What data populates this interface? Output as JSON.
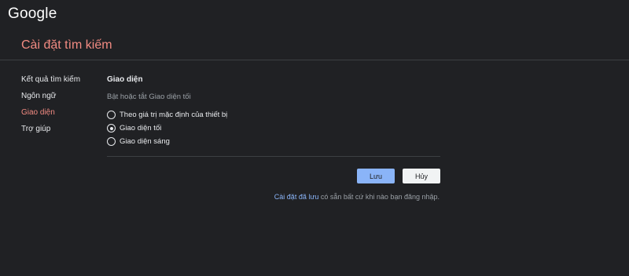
{
  "app": {
    "logo": "Google"
  },
  "header": {
    "title": "Cài đặt tìm kiếm"
  },
  "sidebar": {
    "items": [
      {
        "label": "Kết quả tìm kiếm"
      },
      {
        "label": "Ngôn ngữ"
      },
      {
        "label": "Giao diện",
        "active": true
      },
      {
        "label": "Trợ giúp"
      }
    ]
  },
  "main": {
    "section_title": "Giao diện",
    "section_desc": "Bật hoặc tắt Giao diện tối",
    "options": [
      {
        "label": "Theo giá trị mặc định của thiết bị",
        "selected": false
      },
      {
        "label": "Giao diện tối",
        "selected": true
      },
      {
        "label": "Giao diện sáng",
        "selected": false
      }
    ]
  },
  "actions": {
    "save_label": "Lưu",
    "cancel_label": "Hủy"
  },
  "footer": {
    "link_text": "Cài đặt đã lưu",
    "text": " có sẵn bất cứ khi nào bạn đăng nhập."
  },
  "colors": {
    "background": "#202124",
    "accent_red": "#f28b82",
    "accent_blue": "#8ab4f8"
  }
}
